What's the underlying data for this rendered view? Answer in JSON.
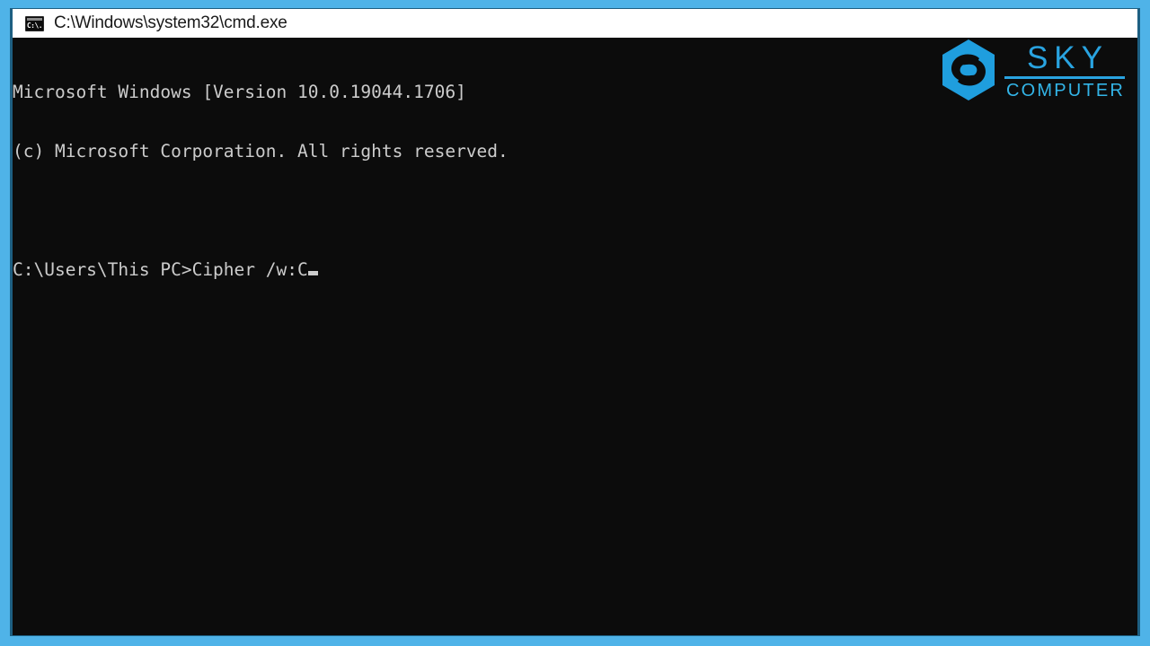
{
  "window": {
    "title": "C:\\Windows\\system32\\cmd.exe",
    "icon": "cmd-console-icon",
    "icon_glyph": "C:\\.",
    "background_color": "#0c0c0c",
    "titlebar_color": "#ffffff",
    "text_color": "#cccccc"
  },
  "frame": {
    "border_color": "#4fb3e8",
    "inner_edge_color": "#1d5f82"
  },
  "console": {
    "lines": [
      "Microsoft Windows [Version 10.0.19044.1706]",
      "(c) Microsoft Corporation. All rights reserved.",
      "",
      "C:\\Users\\This PC>Cipher /w:C"
    ],
    "prompt": "C:\\Users\\This PC>",
    "command": "Cipher /w:C",
    "cursor": "block-underscore-cursor"
  },
  "logo": {
    "mark": "hexagon-s-icon",
    "primary": "SKY",
    "secondary": "COMPUTER",
    "color_primary": "#29a3e0",
    "color_secondary": "#33b5e8"
  }
}
